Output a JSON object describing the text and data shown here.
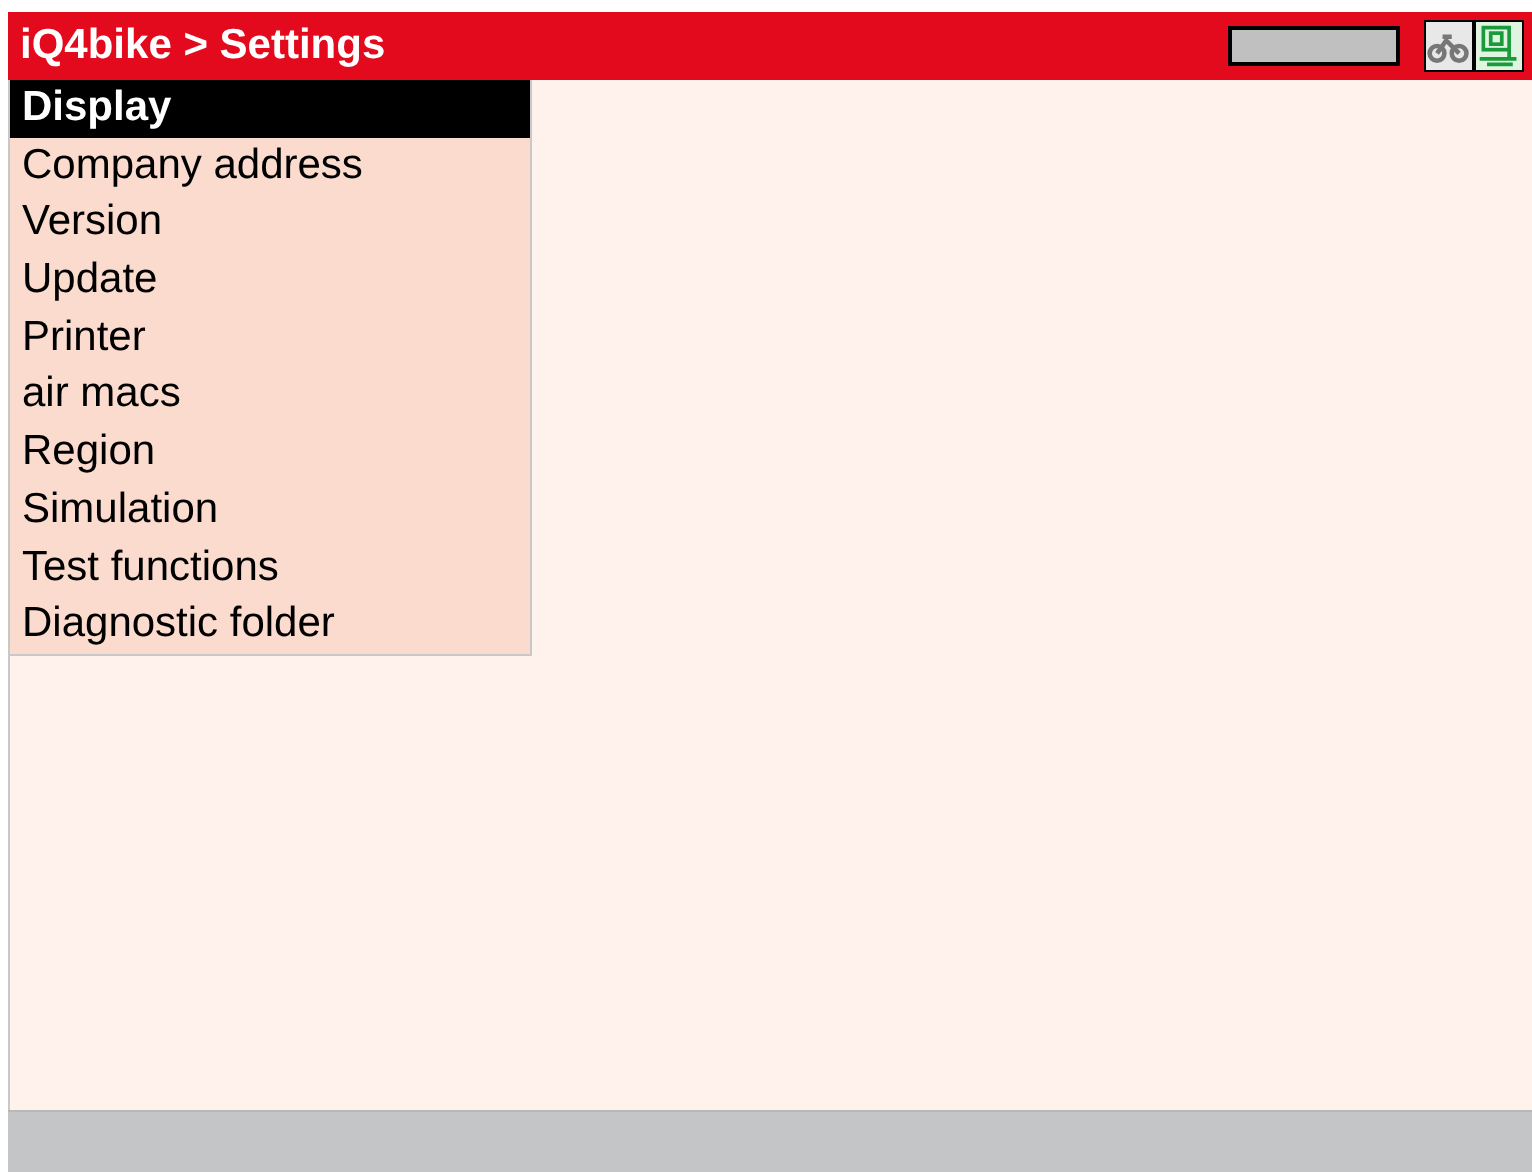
{
  "header": {
    "title": "iQ4bike > Settings"
  },
  "menu": {
    "items": [
      {
        "label": "Display",
        "selected": true
      },
      {
        "label": "Company address",
        "selected": false
      },
      {
        "label": "Version",
        "selected": false
      },
      {
        "label": "Update",
        "selected": false
      },
      {
        "label": "Printer",
        "selected": false
      },
      {
        "label": "air macs",
        "selected": false
      },
      {
        "label": "Region",
        "selected": false
      },
      {
        "label": "Simulation",
        "selected": false
      },
      {
        "label": "Test functions",
        "selected": false
      },
      {
        "label": "Diagnostic folder",
        "selected": false
      }
    ]
  }
}
